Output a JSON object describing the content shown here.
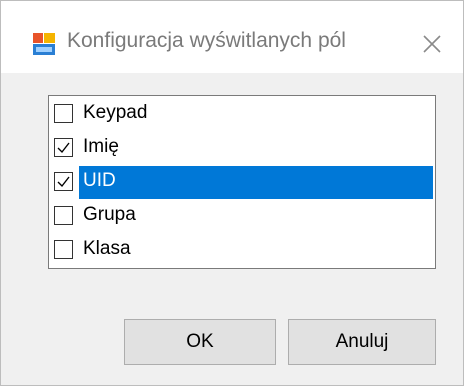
{
  "window": {
    "title": "Konfiguracja wyświtlanych pól",
    "app_icon": "app-window-icon",
    "close_icon": "close-icon"
  },
  "fields_list": {
    "items": [
      {
        "label": "Keypad",
        "checked": false,
        "selected": false
      },
      {
        "label": "Imię",
        "checked": true,
        "selected": false
      },
      {
        "label": "UID",
        "checked": true,
        "selected": true
      },
      {
        "label": "Grupa",
        "checked": false,
        "selected": false
      },
      {
        "label": "Klasa",
        "checked": false,
        "selected": false
      }
    ]
  },
  "buttons": {
    "ok_label": "OK",
    "cancel_label": "Anuluj"
  },
  "colors": {
    "selection": "#0078d7",
    "dialog_background": "#f0f0f0",
    "title_text": "#7a7a7a"
  }
}
